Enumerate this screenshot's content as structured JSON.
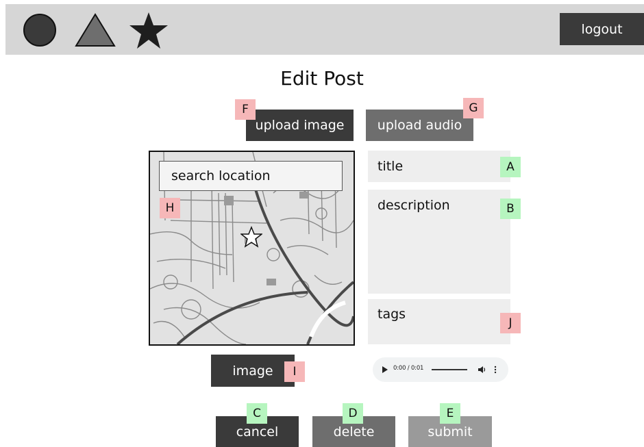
{
  "header": {
    "icons": [
      "circle-icon",
      "triangle-icon",
      "star-icon"
    ],
    "logout_label": "logout"
  },
  "page": {
    "title": "Edit Post"
  },
  "uploads": {
    "image_label": "upload image",
    "audio_label": "upload audio"
  },
  "map": {
    "search_placeholder": "search location"
  },
  "form": {
    "title_placeholder": "title",
    "description_placeholder": "description",
    "tags_placeholder": "tags"
  },
  "image_button_label": "image",
  "audio_player": {
    "time": "0:00 / 0:01"
  },
  "actions": {
    "cancel_label": "cancel",
    "delete_label": "delete",
    "submit_label": "submit"
  },
  "markers": {
    "A": "A",
    "B": "B",
    "C": "C",
    "D": "D",
    "E": "E",
    "F": "F",
    "G": "G",
    "H": "H",
    "I": "I",
    "J": "J"
  },
  "colors": {
    "topbar": "#d6d6d6",
    "dark_button": "#3a3a3a",
    "mid_button": "#6e6e6e",
    "light_button": "#9a9a9a",
    "field_bg": "#eeeeee",
    "marker_red": "#f6b7b8",
    "marker_green": "#b6f5bf"
  }
}
